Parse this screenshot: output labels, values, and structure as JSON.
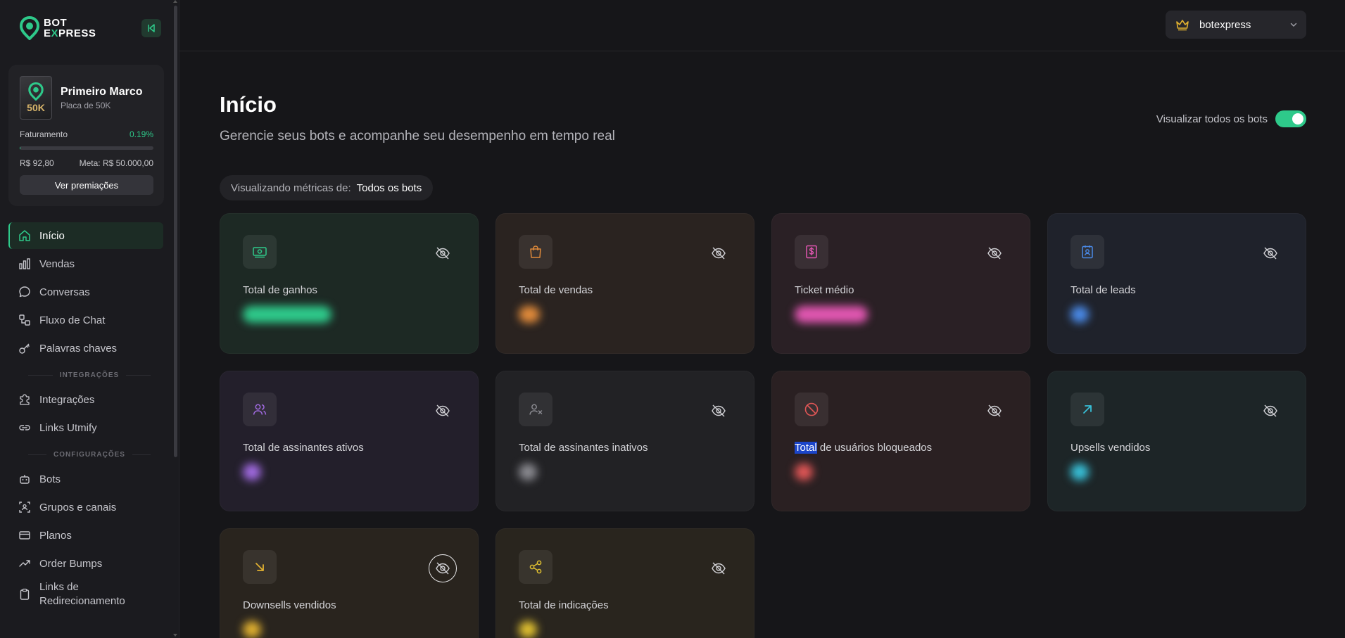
{
  "brand": {
    "line1": "BOT",
    "line2_prefix": "E",
    "line2_x": "X",
    "line2_rest": "PRESS"
  },
  "award": {
    "title": "Primeiro Marco",
    "subtitle": "Placa de 50K",
    "plaque_label": "50K",
    "billing_label": "Faturamento",
    "billing_pct": "0.19%",
    "progress_fraction": 0.0019,
    "current": "R$ 92,80",
    "goal": "Meta: R$ 50.000,00",
    "button": "Ver premiações"
  },
  "nav": {
    "items": [
      {
        "label": "Início",
        "icon": "home-icon"
      },
      {
        "label": "Vendas",
        "icon": "bar-chart-icon"
      },
      {
        "label": "Conversas",
        "icon": "chat-icon"
      },
      {
        "label": "Fluxo de Chat",
        "icon": "flow-icon"
      },
      {
        "label": "Palavras chaves",
        "icon": "key-icon"
      }
    ],
    "section_integrations": "INTEGRAÇÕES",
    "integrations": [
      {
        "label": "Integrações",
        "icon": "puzzle-icon"
      },
      {
        "label": "Links Utmify",
        "icon": "link-icon"
      }
    ],
    "section_settings": "CONFIGURAÇÕES",
    "settings": [
      {
        "label": "Bots",
        "icon": "bot-icon"
      },
      {
        "label": "Grupos e canais",
        "icon": "group-icon"
      },
      {
        "label": "Planos",
        "icon": "card-icon"
      },
      {
        "label": "Order Bumps",
        "icon": "trend-icon"
      },
      {
        "label": "Links de Redirecionamento",
        "icon": "clipboard-icon"
      }
    ]
  },
  "account": {
    "name": "botexpress",
    "icon": "crown-icon"
  },
  "page": {
    "title": "Início",
    "subtitle": "Gerencie seus bots e acompanhe seu desempenho em tempo real",
    "toggle_label": "Visualizar todos os bots",
    "filter_prefix": "Visualizando métricas de:",
    "filter_value": "Todos os bots"
  },
  "cards": [
    {
      "label": "Total de ganhos",
      "icon": "money-icon",
      "accent": "#2ec98a",
      "bg": "#1d2924"
    },
    {
      "label": "Total de vendas",
      "icon": "bag-icon",
      "accent": "#e08a3a",
      "bg": "#2a2320"
    },
    {
      "label": "Ticket médio",
      "icon": "receipt-icon",
      "accent": "#e056b0",
      "bg": "#2a2025"
    },
    {
      "label": "Total de leads",
      "icon": "contact-icon",
      "accent": "#4a8ae8",
      "bg": "#1f222b"
    },
    {
      "label": "Total de assinantes ativos",
      "icon": "users-icon",
      "accent": "#a06ae0",
      "bg": "#231f2b"
    },
    {
      "label": "Total de assinantes inativos",
      "icon": "user-x-icon",
      "accent": "#8a8a90",
      "bg": "#222225"
    },
    {
      "label_hl": "Total",
      "label": " de usuários bloqueados",
      "icon": "ban-icon",
      "accent": "#e05656",
      "bg": "#2a2022"
    },
    {
      "label": "Upsells vendidos",
      "icon": "arrow-up-right-icon",
      "accent": "#38c0d8",
      "bg": "#1d2527"
    },
    {
      "label": "Downsells vendidos",
      "icon": "arrow-down-right-icon",
      "accent": "#e0b030",
      "bg": "#29241e"
    },
    {
      "label": "Total de indicações",
      "icon": "share-icon",
      "accent": "#e0c030",
      "bg": "#29251e"
    }
  ]
}
